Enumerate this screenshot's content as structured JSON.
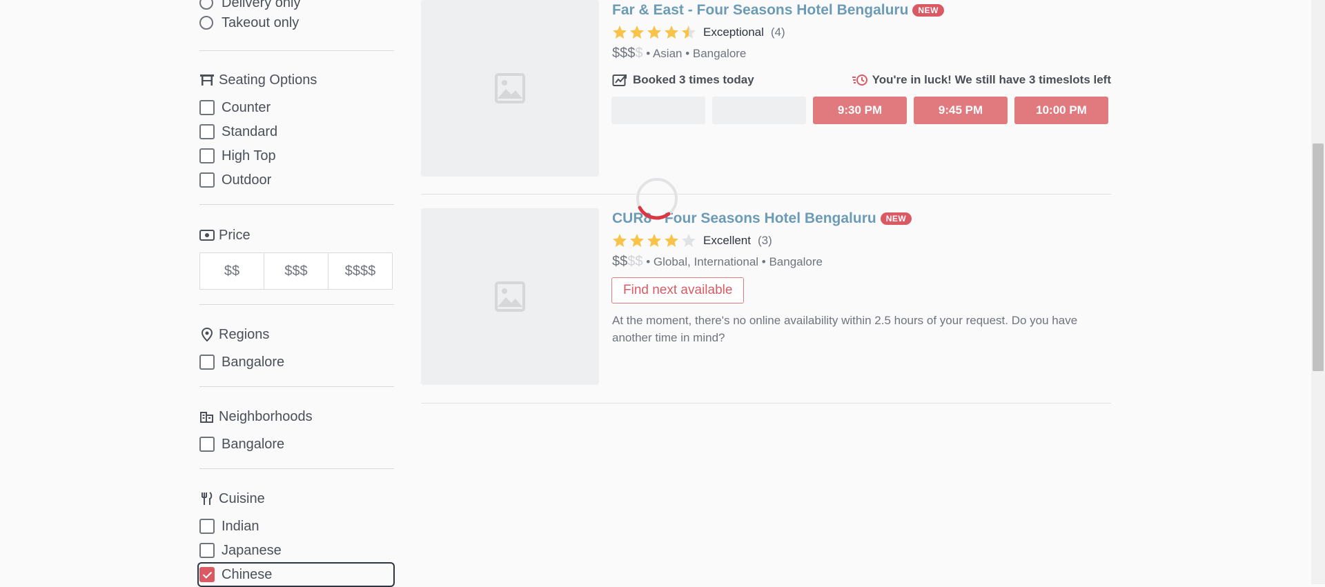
{
  "sidebar": {
    "delivery_only": "Delivery only",
    "takeout_only": "Takeout only",
    "seating": {
      "title": "Seating Options",
      "options": [
        "Counter",
        "Standard",
        "High Top",
        "Outdoor"
      ]
    },
    "price": {
      "title": "Price",
      "options": [
        "$$",
        "$$$",
        "$$$$"
      ]
    },
    "regions": {
      "title": "Regions",
      "options": [
        "Bangalore"
      ]
    },
    "neighborhoods": {
      "title": "Neighborhoods",
      "options": [
        "Bangalore"
      ]
    },
    "cuisine": {
      "title": "Cuisine",
      "options": [
        "Indian",
        "Japanese",
        "Chinese"
      ],
      "checked": [
        "Chinese"
      ]
    }
  },
  "results": [
    {
      "name": "Far & East - Four Seasons Hotel Bengaluru",
      "badge": "NEW",
      "rating": 4.5,
      "rating_word": "Exceptional",
      "review_count": "(4)",
      "price_on": "$$$",
      "price_off": "$",
      "meta": " • Asian • Bangalore",
      "booked": "Booked 3 times today",
      "luck": "You're in luck! We still have 3 timeslots left",
      "slots": [
        "",
        "",
        "9:30 PM",
        "9:45 PM",
        "10:00 PM"
      ]
    },
    {
      "name": "CUR8 - Four Seasons Hotel Bengaluru",
      "badge": "NEW",
      "rating": 4,
      "rating_word": "Excellent",
      "review_count": "(3)",
      "price_on": "$$",
      "price_off": "$$",
      "meta": " • Global, International • Bangalore",
      "find_next": "Find next available",
      "note": "At the moment, there's no online availability within 2.5 hours of your request. Do you have another time in mind?"
    }
  ],
  "colors": {
    "accent": "#da5a64",
    "slot": "#e07a7f",
    "link": "#6b9bb5",
    "star": "#f7c34b"
  }
}
